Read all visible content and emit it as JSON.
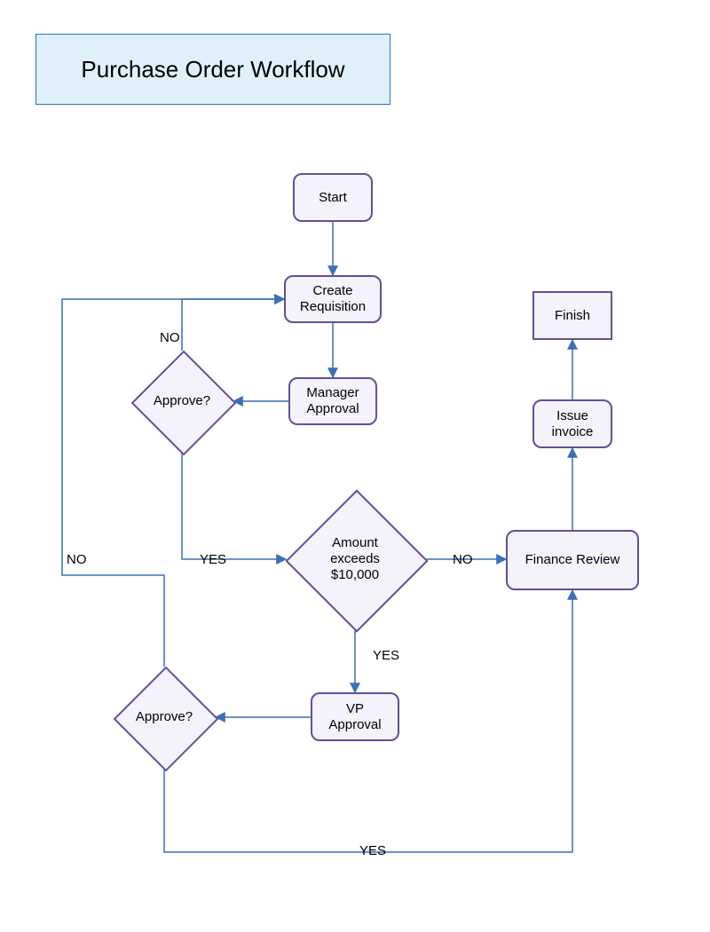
{
  "title": "Purchase Order Workflow",
  "nodes": {
    "start": "Start",
    "createRequisition": "Create\nRequisition",
    "managerApproval": "Manager\nApproval",
    "approve1": "Approve?",
    "amountExceeds": "Amount\nexceeds\n$10,000",
    "vpApproval": "VP\nApproval",
    "approve2": "Approve?",
    "financeReview": "Finance Review",
    "issueInvoice": "Issue\ninvoice",
    "finish": "Finish"
  },
  "edgeLabels": {
    "approve1No": "NO",
    "approve1Yes": "YES",
    "amountNo": "NO",
    "amountYes": "YES",
    "approve2No": "NO",
    "approve2Yes": "YES"
  },
  "colors": {
    "titleBg": "#e0f0fb",
    "titleBorder": "#1f74bf",
    "nodeFill": "#f4f2fa",
    "nodeStroke": "#624f99",
    "arrowStroke": "#3b6fb6"
  }
}
